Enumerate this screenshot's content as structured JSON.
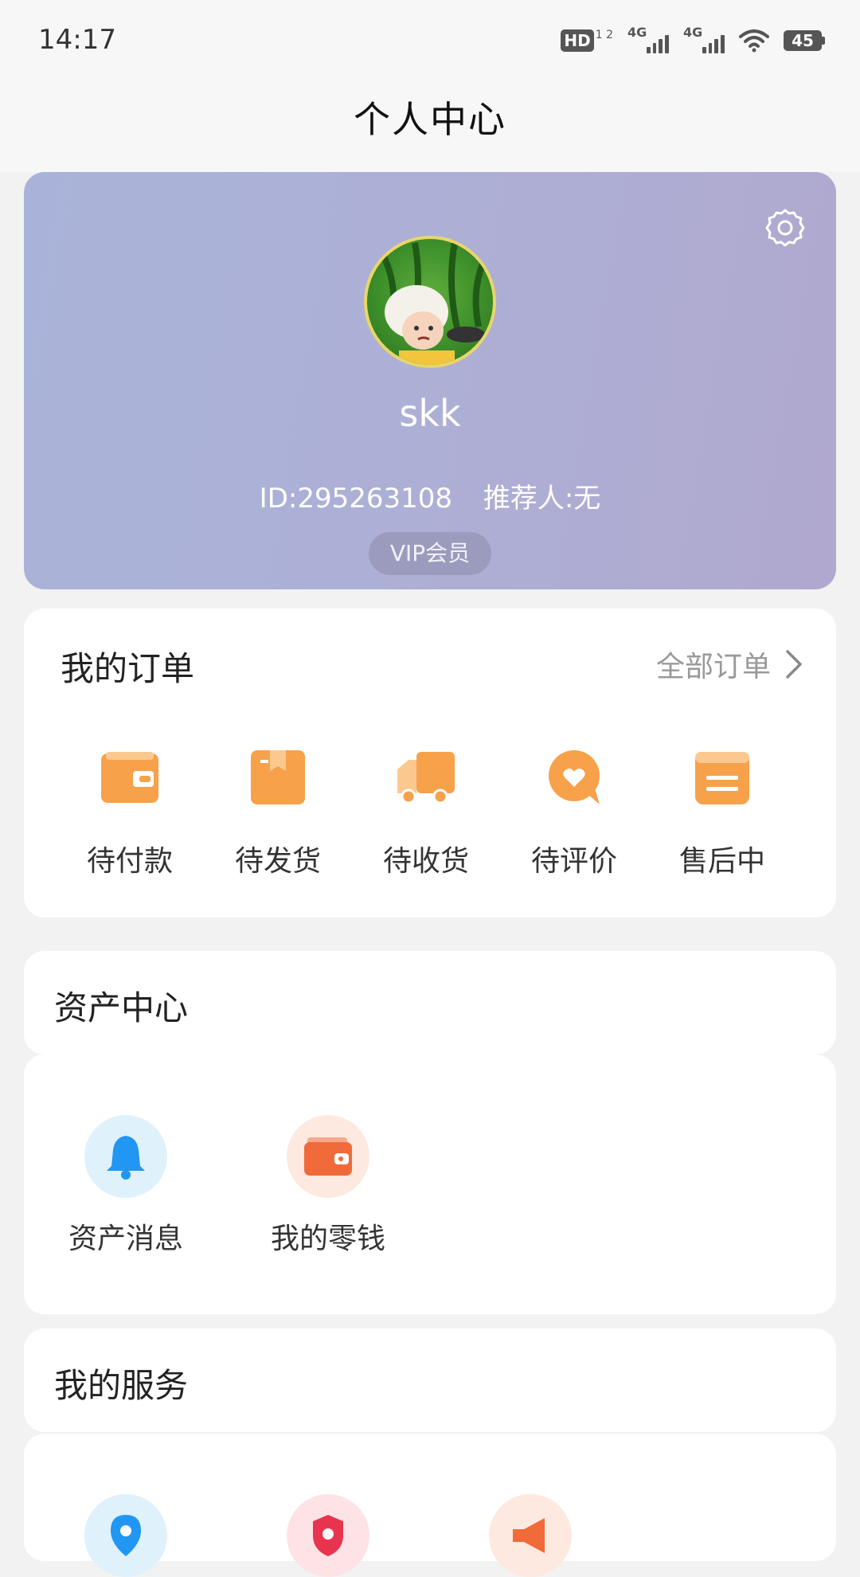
{
  "status_bar": {
    "time": "14:17",
    "hd_label": "HD",
    "hd_sub": "1 2",
    "signal1": "4G",
    "signal2": "4G",
    "battery": "45",
    "icons": [
      "hd-icon",
      "signal-4g-icon",
      "signal-4g-icon",
      "wifi-icon",
      "battery-icon"
    ]
  },
  "header": {
    "title": "个人中心"
  },
  "profile": {
    "username": "skk",
    "id_text": "ID:295263108",
    "referrer_text": "推荐人:无",
    "badge": "VIP会员",
    "settings_icon": "gear-icon",
    "gradient": [
      "#a9b3d9",
      "#b0a8ce"
    ]
  },
  "orders": {
    "title": "我的订单",
    "all_label": "全部订单",
    "items": [
      {
        "label": "待付款",
        "icon": "wallet-icon"
      },
      {
        "label": "待发货",
        "icon": "package-icon"
      },
      {
        "label": "待收货",
        "icon": "truck-icon"
      },
      {
        "label": "待评价",
        "icon": "comment-heart-icon"
      },
      {
        "label": "售后中",
        "icon": "list-box-icon"
      }
    ],
    "accent": "#f7a14a"
  },
  "assets": {
    "title": "资产中心",
    "items": [
      {
        "label": "资产消息",
        "icon": "bell-icon",
        "color": "#2196f3"
      },
      {
        "label": "我的零钱",
        "icon": "wallet-icon",
        "color": "#f06a3a"
      }
    ]
  },
  "services": {
    "title": "我的服务",
    "icons": [
      "location-pin-icon",
      "shield-icon",
      "megaphone-icon"
    ]
  }
}
